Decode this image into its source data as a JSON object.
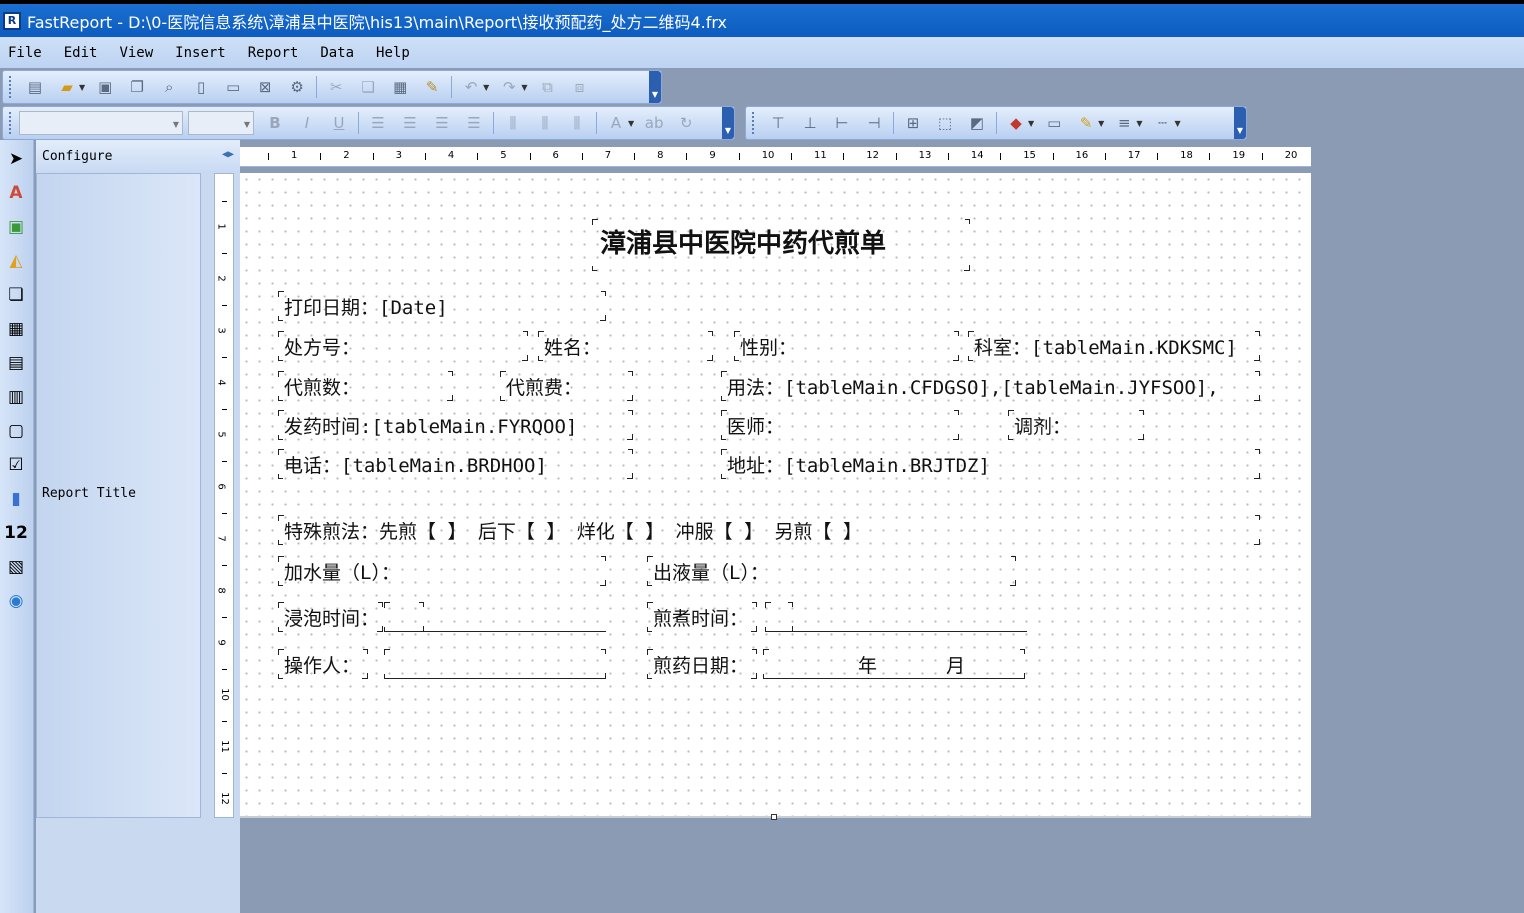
{
  "window": {
    "title": "FastReport - D:\\0-医院信息系统\\漳浦县中医院\\his13\\main\\Report\\接收预配药_处方二维码4.frx",
    "app_icon": "fastreport-icon"
  },
  "menu": [
    "File",
    "Edit",
    "View",
    "Insert",
    "Report",
    "Data",
    "Help"
  ],
  "tree": {
    "header": "Configure",
    "band_label": "Report Title"
  },
  "ruler": {
    "h": [
      "1",
      "2",
      "3",
      "4",
      "5",
      "6",
      "7",
      "8",
      "9",
      "10",
      "11",
      "12",
      "13",
      "14",
      "15",
      "16",
      "17",
      "18",
      "19",
      "20"
    ],
    "v": [
      "1",
      "2",
      "3",
      "4",
      "5",
      "6",
      "7",
      "8",
      "9",
      "10",
      "11",
      "12"
    ]
  },
  "report": {
    "title": "漳浦县中医院中药代煎单",
    "print_date": "打印日期：[Date]",
    "rx_no": "处方号：",
    "name": "姓名：",
    "gender": "性别：",
    "dept": "科室：[tableMain.KDKSMC]",
    "decoct_count": "代煎数：",
    "decoct_fee": "代煎费：",
    "usage": "用法：[tableMain.CFDGSO],[tableMain.JYFSOO],",
    "dispense_time": "发药时间:[tableMain.FYRQOO]",
    "doctor": "医师：",
    "mixer": "调剂：",
    "phone": "电话：[tableMain.BRDHOO]",
    "address": "地址：[tableMain.BRJTDZ]",
    "special": "特殊煎法：先煎【 】  后下【 】  烊化【 】  冲服【  】  另煎【  】",
    "water": "加水量（L）：",
    "output": "出液量（L）：",
    "soak": "浸泡时间：",
    "boil": "煎煮时间：",
    "operator": "操作人：",
    "decoct_date": "煎药日期：",
    "year": "年",
    "month": "月"
  }
}
